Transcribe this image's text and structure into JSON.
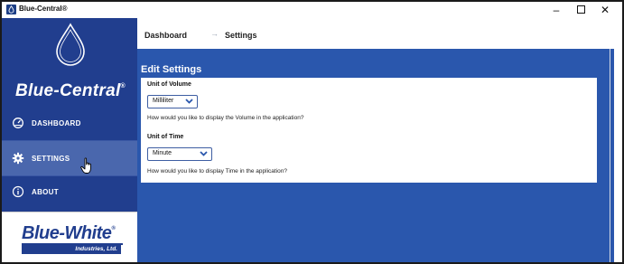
{
  "window": {
    "title": "Blue-Central®",
    "minimize_glyph": "–",
    "close_glyph": "✕"
  },
  "sidebar": {
    "brand": "Blue-Central",
    "brand_mark": "®",
    "items": [
      {
        "label": "DASHBOARD",
        "icon": "gauge-icon"
      },
      {
        "label": "SETTINGS",
        "icon": "gear-icon",
        "selected": true
      },
      {
        "label": "ABOUT",
        "icon": "info-icon"
      }
    ],
    "footer_logo": {
      "name": "Blue-White",
      "mark": "®",
      "tagline": "Industries, Ltd."
    }
  },
  "breadcrumb": {
    "items": [
      "Dashboard",
      "Settings"
    ],
    "separator": "→"
  },
  "settings": {
    "title": "Edit Settings",
    "volume": {
      "label": "Unit of Volume",
      "value": "Milliliter",
      "help": "How would you like to display the Volume in the application?"
    },
    "time": {
      "label": "Unit of Time",
      "value": "Minute",
      "help": "How would you like to display Time in the application?"
    }
  },
  "colors": {
    "sidebar": "#213e8e",
    "sidebar_selected": "#4a67ad",
    "content": "#2a57ad",
    "select_border": "#3e5ea2"
  }
}
